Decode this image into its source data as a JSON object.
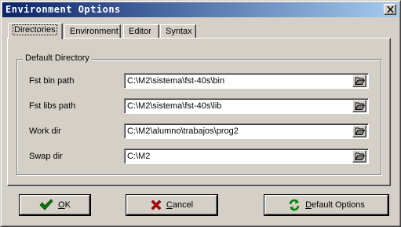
{
  "window": {
    "title": "Environment Options"
  },
  "tabs": [
    {
      "label": "Directories",
      "active": true
    },
    {
      "label": "Environment",
      "active": false
    },
    {
      "label": "Editor",
      "active": false
    },
    {
      "label": "Syntax",
      "active": false
    }
  ],
  "group": {
    "legend": "Default Directory",
    "rows": [
      {
        "label": "Fst bin path",
        "value": "C:\\M2\\sistema\\fst-40s\\bin"
      },
      {
        "label": "Fst libs path",
        "value": "C:\\M2\\sistema\\fst-40s\\lib"
      },
      {
        "label": "Work dir",
        "value": "C:\\M2\\alumno\\trabajos\\prog2"
      },
      {
        "label": "Swap dir",
        "value": "C:\\M2"
      }
    ]
  },
  "buttons": {
    "ok": {
      "label": "OK",
      "mnemonic": "O",
      "rest": "K",
      "icon": "checkmark-icon"
    },
    "cancel": {
      "label": "Cancel",
      "mnemonic": "C",
      "rest": "ancel",
      "icon": "x-cross-icon"
    },
    "default": {
      "label": "Default Options",
      "mnemonic": "D",
      "rest": "efault Options",
      "icon": "refresh-arrows-icon"
    }
  },
  "colors": {
    "titlebar_start": "#0a246a",
    "titlebar_end": "#a6caf0",
    "face": "#d4d0c8",
    "check_green": "#008000",
    "cross_red": "#c00000"
  }
}
